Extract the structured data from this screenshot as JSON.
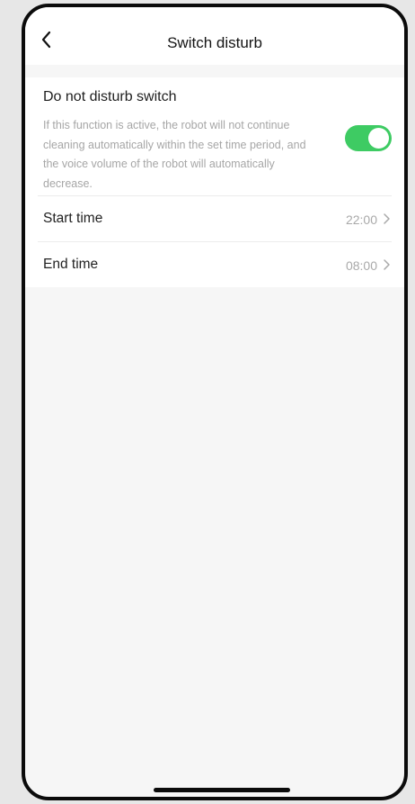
{
  "header": {
    "title": "Switch disturb",
    "back_icon": "chevron-left-icon"
  },
  "dnd": {
    "title": "Do not disturb switch",
    "description": "If this function is active, the robot will not continue cleaning automatically within the set time period, and the voice volume of the robot will automatically decrease.",
    "enabled": true,
    "toggle_color": "#3ecb63"
  },
  "start_time": {
    "label": "Start time",
    "value": "22:00",
    "icon": "chevron-right-icon"
  },
  "end_time": {
    "label": "End time",
    "value": "08:00",
    "icon": "chevron-right-icon"
  }
}
